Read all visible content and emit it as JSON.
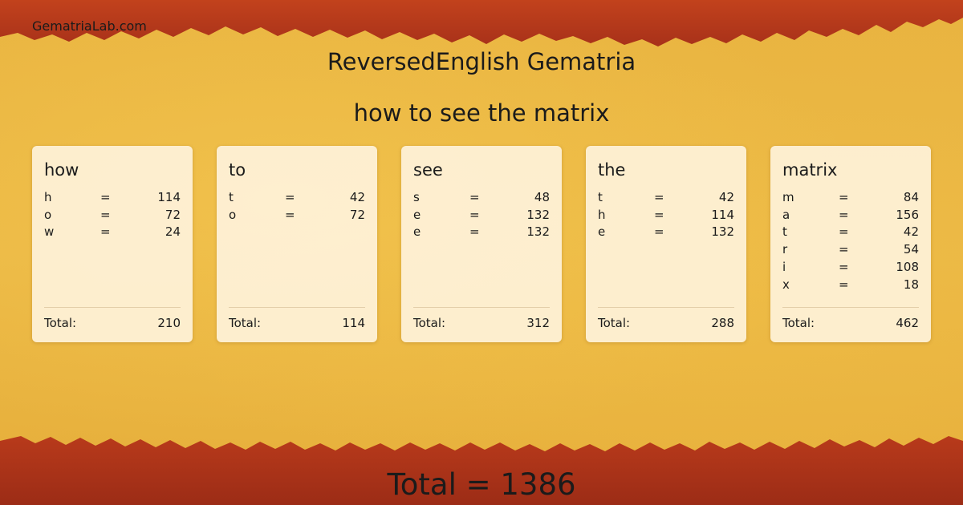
{
  "header": {
    "site": "GematriaLab.com",
    "title": "ReversedEnglish Gematria",
    "phrase": "how to see the matrix"
  },
  "colors": {
    "edge": "#b8391a",
    "background": "#e9b440",
    "card": "#fff5e1"
  },
  "words": [
    {
      "word": "how",
      "letters": [
        {
          "l": "h",
          "eq": "=",
          "v": "114"
        },
        {
          "l": "o",
          "eq": "=",
          "v": "72"
        },
        {
          "l": "w",
          "eq": "=",
          "v": "24"
        }
      ],
      "total_label": "Total:",
      "total": "210"
    },
    {
      "word": "to",
      "letters": [
        {
          "l": "t",
          "eq": "=",
          "v": "42"
        },
        {
          "l": "o",
          "eq": "=",
          "v": "72"
        }
      ],
      "total_label": "Total:",
      "total": "114"
    },
    {
      "word": "see",
      "letters": [
        {
          "l": "s",
          "eq": "=",
          "v": "48"
        },
        {
          "l": "e",
          "eq": "=",
          "v": "132"
        },
        {
          "l": "e",
          "eq": "=",
          "v": "132"
        }
      ],
      "total_label": "Total:",
      "total": "312"
    },
    {
      "word": "the",
      "letters": [
        {
          "l": "t",
          "eq": "=",
          "v": "42"
        },
        {
          "l": "h",
          "eq": "=",
          "v": "114"
        },
        {
          "l": "e",
          "eq": "=",
          "v": "132"
        }
      ],
      "total_label": "Total:",
      "total": "288"
    },
    {
      "word": "matrix",
      "letters": [
        {
          "l": "m",
          "eq": "=",
          "v": "84"
        },
        {
          "l": "a",
          "eq": "=",
          "v": "156"
        },
        {
          "l": "t",
          "eq": "=",
          "v": "42"
        },
        {
          "l": "r",
          "eq": "=",
          "v": "54"
        },
        {
          "l": "i",
          "eq": "=",
          "v": "108"
        },
        {
          "l": "x",
          "eq": "=",
          "v": "18"
        }
      ],
      "total_label": "Total:",
      "total": "462"
    }
  ],
  "grand_total": "Total = 1386"
}
